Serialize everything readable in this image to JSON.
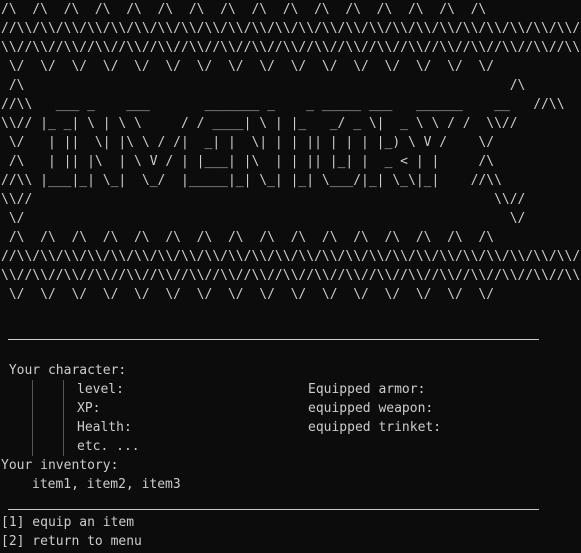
{
  "banner": {
    "ascii_art": "/\\  /\\  /\\  /\\  /\\  /\\  /\\  /\\  /\\  /\\  /\\  /\\  /\\  /\\  /\\  /\\\n//\\\\/\\\\/\\\\/\\\\/\\\\/\\\\/\\\\/\\\\/\\\\/\\\\/\\\\/\\\\/\\\\/\\\\/\\\\/\\\\/\\\\/\\\\/\\\\/\\\\/\\\\/\\\\/\\\\/\\\\/\\\\/\\\\/\\\\/\\\\/\\\\/\\\\/\\\\/\\\\/\\\\/\\\\/\\\\\n\\\\//\\\\//\\\\//\\\\//\\\\//\\\\//\\\\//\\\\//\\\\//\\\\//\\\\//\\\\//\\\\//\\\\//\\\\//\\\\//\\\\//\\\\//\\\\//\\\\//\\\\//\\\\//\\\\//\\\\//\\\\//\\\\//\\\\//\\\\//\\\\//\\\\//\\\\//\\\\//\\\\//\\\\//\\\\//\n \\/  \\/  \\/  \\/  \\/  \\/  \\/  \\/  \\/  \\/  \\/  \\/  \\/  \\/  \\/  \\/\n /\\                                                              /\\\n//\\\\   ___ _    ___       _______ _    _ _____ ___   ______    __   //\\\\\n\\\\// |_ _| \\ | \\ \\     / / ____| \\ | |_   _/ _ \\|  _ \\ \\ / /  \\\\//\n \\/   | ||  \\| |\\ \\ / /|  _| |  \\| | | || | | | |_) \\ V /    \\/\n /\\   | || |\\  | \\ V / | |___| |\\  | | || |_| |  _ < | |     /\\\n//\\\\ |___|_| \\_|  \\_/  |_____|_| \\_| |_| \\___/|_| \\_\\|_|    //\\\\\n\\\\//                                                           \\\\//\n \\/                                                              \\/\n /\\  /\\  /\\  /\\  /\\  /\\  /\\  /\\  /\\  /\\  /\\  /\\  /\\  /\\  /\\  /\\\n//\\\\/\\\\/\\\\/\\\\/\\\\/\\\\/\\\\/\\\\/\\\\/\\\\/\\\\/\\\\/\\\\/\\\\/\\\\/\\\\/\\\\/\\\\/\\\\/\\\\/\\\\/\\\\/\\\\/\\\\/\\\\/\\\\/\\\\/\\\\/\\\\/\\\\/\\\\/\\\\/\\\\/\\\\/\\\\\n\\\\//\\\\//\\\\//\\\\//\\\\//\\\\//\\\\//\\\\//\\\\//\\\\//\\\\//\\\\//\\\\//\\\\//\\\\//\\\\//\\\\//\\\\//\\\\//\\\\//\\\\//\\\\//\\\\//\\\\//\\\\//\\\\//\\\\//\\\\//\\\\//\\\\//\\\\//\\\\//\\\\//\\\\//\\\\//\n \\/  \\/  \\/  \\/  \\/  \\/  \\/  \\/  \\/  \\/  \\/  \\/  \\/  \\/  \\/  \\/"
  },
  "character": {
    "heading": " Your character:",
    "stats": [
      "level:",
      "XP:",
      "Health:",
      "etc. ..."
    ],
    "equipment": [
      "Equipped armor:",
      "equipped weapon:",
      "equipped trinket:"
    ]
  },
  "inventory": {
    "heading": "Your inventory:",
    "items": "item1, item2, item3"
  },
  "menu": {
    "options": [
      "[1] equip an item",
      "[2] return to menu"
    ]
  }
}
